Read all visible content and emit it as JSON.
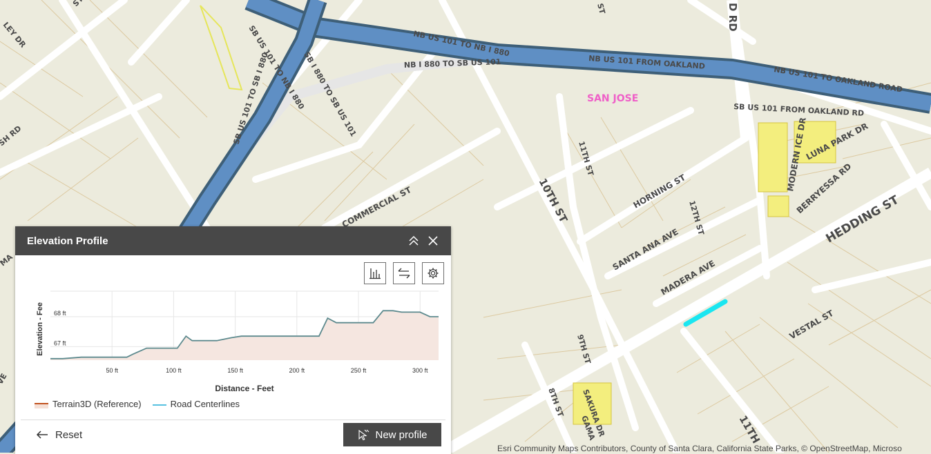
{
  "map": {
    "labels": {
      "nb101_to_nb880": "NB US 101 TO NB I 880",
      "nb101_from_oakland": "NB US 101 FROM OAKLAND",
      "nb880_to_sb101": "NB I 880 TO SB US 101",
      "nb101_to_oakland": "NB US 101 TO OAKLAND ROAD",
      "sb101_from_oakland": "SB US 101 FROM OAKLAND RD",
      "sb101_to_sb880": "SB US 101 TO SB I 880",
      "sb880_to_sb101": "SB I 880 TO SB US 101",
      "sb101_to_nb880": "SB US 101 TO NB I 880",
      "san_jose": "SAN JOSE",
      "commercial_st": "COMMERCIAL ST",
      "tenth_st": "10TH ST",
      "eleventh_st_top": "11TH ST",
      "eleventh_st_bottom": "11TH",
      "twelfth_st": "12TH ST",
      "ninth_st": "9TH ST",
      "eighth_st": "8TH ST",
      "horning_st": "HORNING ST",
      "santa_ana_ave": "SANTA ANA AVE",
      "madera_ave": "MADERA AVE",
      "hedding_st": "HEDDING ST",
      "vestal_st": "VESTAL ST",
      "berryessa_rd": "BERRYESSA RD",
      "modern_ice_dr": "MODERN ICE DR",
      "luna_park_dr": "LUNA PARK DR",
      "sakura_dr": "SAKURA DR",
      "gama": "GAMA",
      "d_rd": "D RD",
      "st_top": "ST",
      "st_top2": "ST",
      "ley_dr": "LEY DR",
      "sh_rd": "SH RD",
      "ma": "MA",
      "ve": "VE"
    },
    "attribution": "Esri Community Maps Contributors, County of Santa Clara, California State Parks, © OpenStreetMap, Microso"
  },
  "panel": {
    "title": "Elevation Profile",
    "tools": [
      "statistics-icon",
      "swap-icon",
      "settings-icon"
    ],
    "legend": [
      {
        "label": "Terrain3D (Reference)",
        "color": "#c1521e"
      },
      {
        "label": "Road Centerlines",
        "color": "#56c1e0"
      }
    ],
    "reset_label": "Reset",
    "new_profile_label": "New profile"
  },
  "chart_data": {
    "type": "area",
    "xlabel": "Distance - Feet",
    "ylabel": "Elevation - Fee",
    "x_ticks": [
      "50 ft",
      "100 ft",
      "150 ft",
      "200 ft",
      "250 ft",
      "300 ft"
    ],
    "y_ticks": [
      "67 ft",
      "68 ft"
    ],
    "xlim": [
      0,
      315
    ],
    "ylim": [
      66.55,
      68.85
    ],
    "series": [
      {
        "name": "Road Centerlines",
        "color": "#56c1e0",
        "x": [
          0,
          10,
          25,
          40,
          50,
          62,
          67,
          78,
          90,
          103,
          110,
          115,
          125,
          135,
          147,
          155,
          165,
          180,
          200,
          218,
          225,
          232,
          245,
          262,
          270,
          278,
          285,
          300,
          308,
          315
        ],
        "y": [
          66.6,
          66.6,
          66.65,
          66.65,
          66.65,
          66.65,
          66.75,
          66.95,
          66.95,
          66.95,
          67.35,
          67.2,
          67.2,
          67.2,
          67.3,
          67.35,
          67.35,
          67.35,
          67.35,
          67.35,
          67.95,
          67.8,
          67.8,
          67.8,
          68.2,
          68.2,
          68.15,
          68.15,
          68.0,
          68.0
        ]
      }
    ]
  }
}
